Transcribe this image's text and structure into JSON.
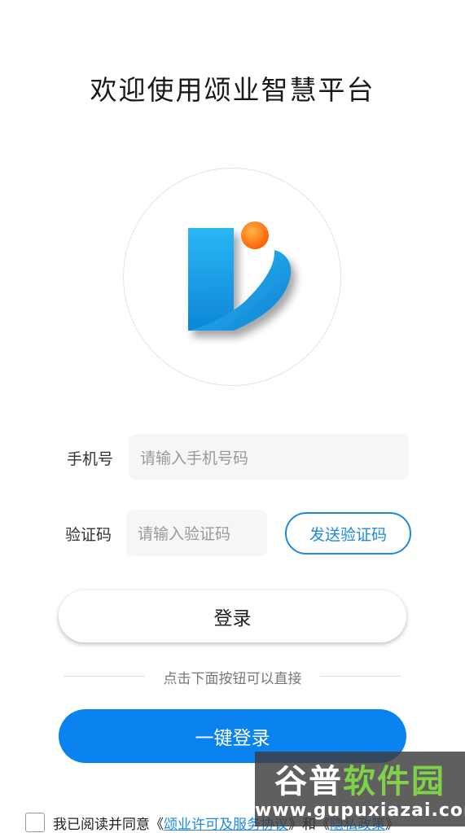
{
  "header": {
    "title": "欢迎使用颂业智慧平台"
  },
  "logo": {
    "name": "logo-icon",
    "brand_colors": [
      "#1aa6ef",
      "#ff6a00"
    ]
  },
  "form": {
    "phone_label": "手机号",
    "phone_placeholder": "请输入手机号码",
    "code_label": "验证码",
    "code_placeholder": "请输入验证码",
    "send_code_label": "发送验证码"
  },
  "actions": {
    "login_label": "登录",
    "divider_text": "点击下面按钮可以直接",
    "onekey_label": "一键登录"
  },
  "agreement": {
    "prefix": "我已阅读并同意《",
    "terms_link": "颂业许可及服务协议",
    "middle": "》和《",
    "privacy_link": "隐私政策",
    "suffix": "》"
  },
  "watermark": {
    "line1_a": "谷普",
    "line1_b": "软件园",
    "line2": "www.gupuxiazai.com"
  },
  "colors": {
    "accent": "#0a82f0",
    "link": "#1e88e5"
  }
}
